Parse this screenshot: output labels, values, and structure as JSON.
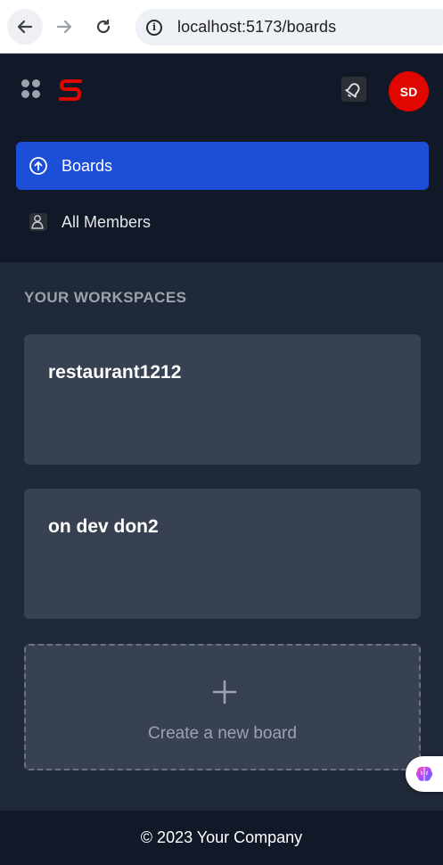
{
  "browser": {
    "url": "localhost:5173/boards"
  },
  "header": {
    "avatar_initials": "SD",
    "avatar_color": "#e10600",
    "logo_color": "#e10600"
  },
  "nav": {
    "items": [
      {
        "label": "Boards",
        "icon": "arrow-up-circle-icon",
        "active": true
      },
      {
        "label": "All Members",
        "icon": "members-icon",
        "active": false
      }
    ],
    "accent_color": "#1d4ed8"
  },
  "workspaces": {
    "title": "YOUR WORKSPACES",
    "boards": [
      {
        "name": "restaurant1212"
      },
      {
        "name": "on dev don2"
      }
    ],
    "create_label": "Create a new board"
  },
  "footer": {
    "text": "© 2023 Your Company"
  }
}
